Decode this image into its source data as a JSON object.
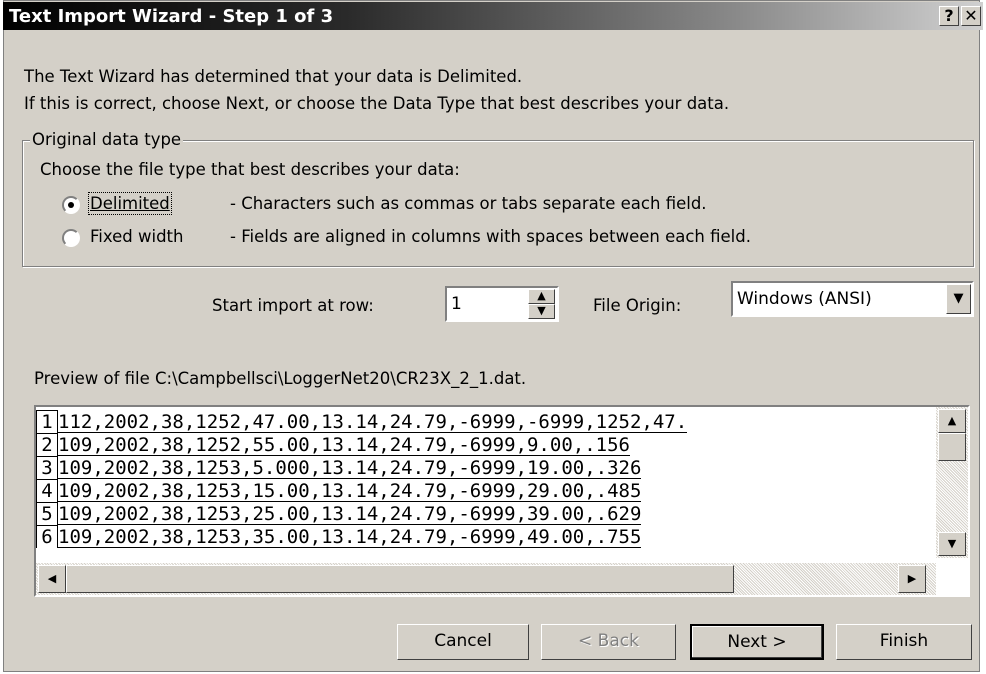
{
  "window": {
    "title": "Text Import Wizard - Step 1 of 3",
    "help_label": "?",
    "close_label": "✕"
  },
  "intro": {
    "line1": "The Text Wizard has determined that your data is Delimited.",
    "line2": "If this is correct, choose Next, or choose the Data Type that best describes your data."
  },
  "group": {
    "legend": "Original data type",
    "prompt": "Choose the file type that best describes your data:",
    "options": [
      {
        "label": "Delimited",
        "desc": "- Characters such as commas or tabs separate each field.",
        "selected": true
      },
      {
        "label": "Fixed width",
        "desc": "- Fields are aligned in columns with spaces between each field.",
        "selected": false
      }
    ]
  },
  "start_row": {
    "label": "Start import at row:",
    "value": "1"
  },
  "file_origin": {
    "label": "File Origin:",
    "value": "Windows (ANSI)"
  },
  "preview": {
    "label": "Preview of file C:\\Campbellsci\\LoggerNet20\\CR23X_2_1.dat.",
    "rows": [
      {
        "num": "1",
        "text": "112,2002,38,1252,47.00,13.14,24.79,-6999,-6999,1252,47."
      },
      {
        "num": "2",
        "text": "109,2002,38,1252,55.00,13.14,24.79,-6999,9.00,.156"
      },
      {
        "num": "3",
        "text": "109,2002,38,1253,5.000,13.14,24.79,-6999,19.00,.326"
      },
      {
        "num": "4",
        "text": "109,2002,38,1253,15.00,13.14,24.79,-6999,29.00,.485"
      },
      {
        "num": "5",
        "text": "109,2002,38,1253,25.00,13.14,24.79,-6999,39.00,.629"
      },
      {
        "num": "6",
        "text": "109,2002,38,1253,35.00,13.14,24.79,-6999,49.00,.755"
      }
    ]
  },
  "buttons": {
    "cancel": "Cancel",
    "back": "< Back",
    "next": "Next >",
    "finish": "Finish"
  },
  "icons": {
    "up": "▲",
    "down": "▼",
    "left": "◀",
    "right": "▶"
  }
}
